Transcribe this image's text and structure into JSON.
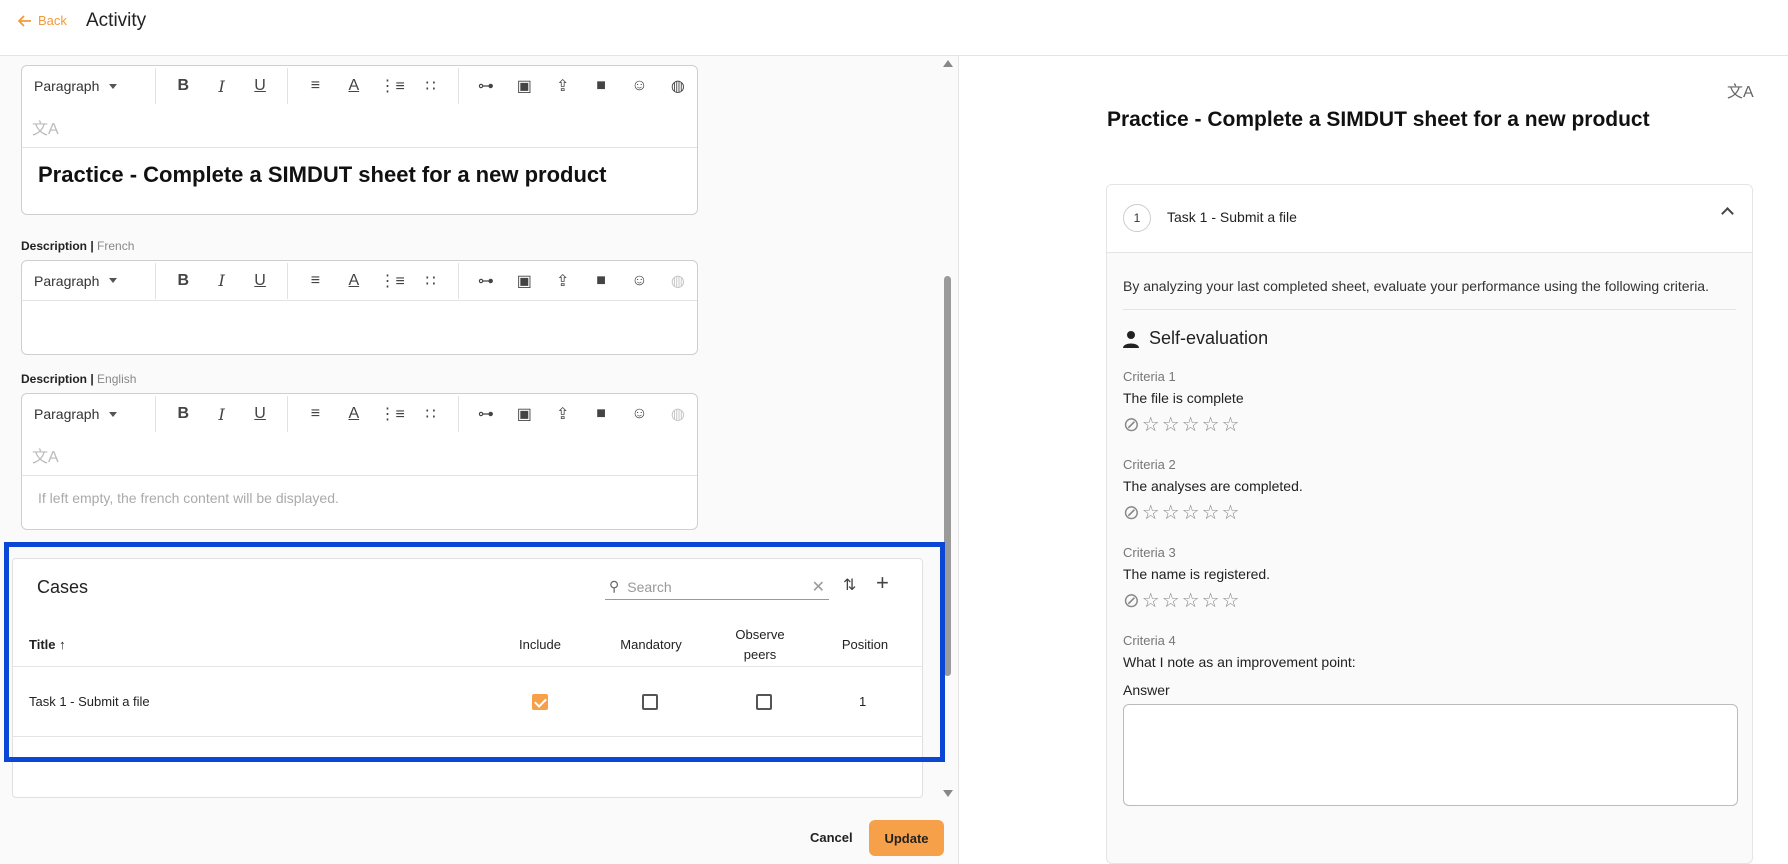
{
  "header": {
    "back_label": "Back",
    "title": "Activity"
  },
  "editors": {
    "title_editor": {
      "paragraph_label": "Paragraph",
      "content": "Practice - Complete a SIMDUT sheet for a new product"
    },
    "desc_fr": {
      "label": "Description",
      "lang": "French",
      "paragraph_label": "Paragraph"
    },
    "desc_en": {
      "label": "Description",
      "lang": "English",
      "paragraph_label": "Paragraph",
      "placeholder": "If left empty, the french content will be displayed."
    }
  },
  "cases": {
    "title": "Cases",
    "search_placeholder": "Search",
    "columns": {
      "title": "Title",
      "include": "Include",
      "mandatory": "Mandatory",
      "observe_peers": "Observe peers",
      "position": "Position"
    },
    "rows": [
      {
        "title": "Task 1 - Submit a file",
        "include": true,
        "mandatory": false,
        "observe_peers": false,
        "position": "1"
      }
    ]
  },
  "footer": {
    "cancel_label": "Cancel",
    "update_label": "Update"
  },
  "preview": {
    "title": "Practice - Complete a SIMDUT sheet for a new product",
    "task": {
      "number": "1",
      "name": "Task 1 - Submit a file",
      "intro": "By analyzing your last completed sheet, evaluate your performance using the following criteria.",
      "section": "Self-evaluation",
      "criteria": [
        {
          "name": "Criteria 1",
          "desc": "The file is complete",
          "rating": 0
        },
        {
          "name": "Criteria 2",
          "desc": "The analyses are completed.",
          "rating": 0
        },
        {
          "name": "Criteria 3",
          "desc": "The name is registered.",
          "rating": 0
        },
        {
          "name": "Criteria 4",
          "desc": "What I note as an improvement point:"
        }
      ],
      "answer_label": "Answer"
    }
  },
  "colors": {
    "accent": "#f7a04a",
    "highlight": "#0a47d6"
  },
  "icons": [
    "arrow-left-icon",
    "bold-icon",
    "italic-icon",
    "underline-icon",
    "align-center-icon",
    "text-color-icon",
    "ordered-list-icon",
    "bullet-list-icon",
    "link-icon",
    "image-icon",
    "file-upload-icon",
    "video-icon",
    "emoji-icon",
    "globe-icon",
    "translate-icon",
    "search-icon",
    "clear-icon",
    "sort-icon",
    "plus-icon",
    "person-icon",
    "star-icon",
    "chevron-up-icon"
  ]
}
